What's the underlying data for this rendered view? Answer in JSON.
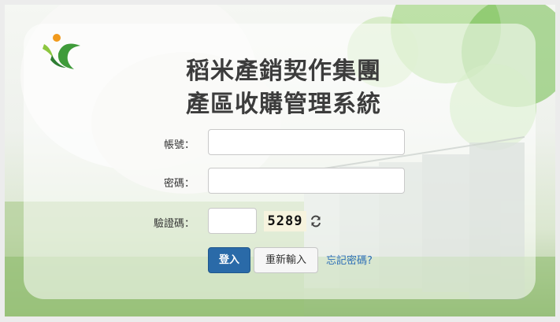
{
  "header": {
    "title_line1": "稻米產銷契作集團",
    "title_line2": "產區收購管理系統"
  },
  "form": {
    "account_label": "帳號：",
    "account_value": "",
    "password_label": "密碼：",
    "password_value": "",
    "captcha_label": "驗證碼：",
    "captcha_value": "",
    "captcha_code": "5289"
  },
  "buttons": {
    "login_label": "登入",
    "reset_label": "重新輸入",
    "forgot_label": "忘記密碼?"
  },
  "icons": {
    "logo": "company-logo",
    "refresh": "refresh-captcha-icon"
  },
  "colors": {
    "primary_button": "#2a6aa8",
    "link": "#2e6fb7",
    "logo_green": "#3f9b3a",
    "logo_orange": "#f19a1d"
  }
}
